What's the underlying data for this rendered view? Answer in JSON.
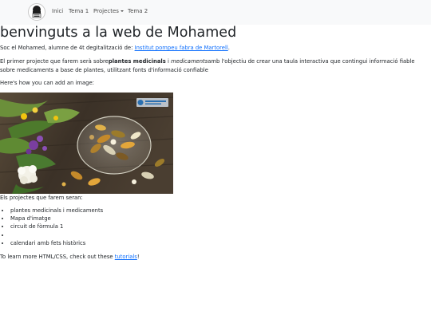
{
  "nav": {
    "items": [
      {
        "label": "Inici"
      },
      {
        "label": "Tema 1"
      },
      {
        "label": "Projectes"
      },
      {
        "label": "Tema 2"
      }
    ]
  },
  "main": {
    "title": "benvinguts a la web de Mohamed",
    "intro": {
      "text": "Soc el Mohamed, alumne de 4t degitalització de: ",
      "link": "Institut pompeu fabra de Martorell",
      "end": "."
    },
    "project": {
      "before": "El primer projecte que farem serà sobre",
      "bold": "plantes medicinals",
      "mid": " i ",
      "italic": "medicaments",
      "after": "amb l'objectiu de crear una taula interactiva que contingui informació fiable sobre medicaments a base de plantes, utilitzant fonts d'informació confiable"
    },
    "image_intro": "Here's how you can add an image:",
    "projects_heading": "Els projectes que farem seran:",
    "projects": [
      "plantes medicinals i medicaments",
      "Mapa d'imatge",
      "circuit de fòrmula 1",
      "",
      "calendari amb fets històrics"
    ],
    "footer": {
      "text": "To learn more HTML/CSS, check out these ",
      "link": "tutorials",
      "end": "!"
    }
  },
  "colors": {
    "navbar_bg": "#f8f9fa",
    "link": "#0d6efd",
    "text": "#212529"
  },
  "icons": {
    "logo": "pharmacy-badge-logo",
    "image": "herbal-pills-photo"
  }
}
